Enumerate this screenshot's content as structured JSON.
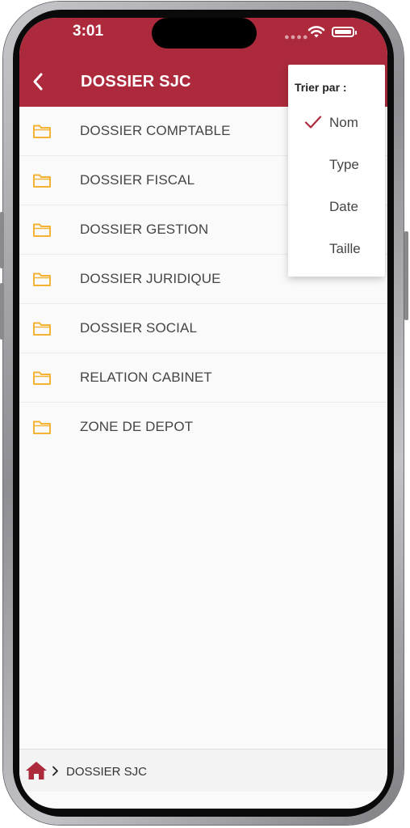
{
  "status": {
    "time": "3:01"
  },
  "header": {
    "title": "DOSSIER SJC"
  },
  "folders": [
    "DOSSIER COMPTABLE",
    "DOSSIER FISCAL",
    "DOSSIER GESTION",
    "DOSSIER JURIDIQUE",
    "DOSSIER SOCIAL",
    "RELATION CABINET",
    "ZONE DE DEPOT"
  ],
  "sort_menu": {
    "title": "Trier par :",
    "options": [
      "Nom",
      "Type",
      "Date",
      "Taille"
    ],
    "selected": "Nom"
  },
  "breadcrumb": {
    "current": "DOSSIER SJC"
  },
  "colors": {
    "brand_red": "#ad2a3c",
    "folder_yellow": "#f5b335",
    "check_red": "#ad2a3c"
  },
  "icons": {
    "back": "chevron-left-icon",
    "folder": "folder-icon",
    "check": "check-icon",
    "home": "home-icon",
    "breadcrumb_separator": "chevron-right-icon"
  }
}
